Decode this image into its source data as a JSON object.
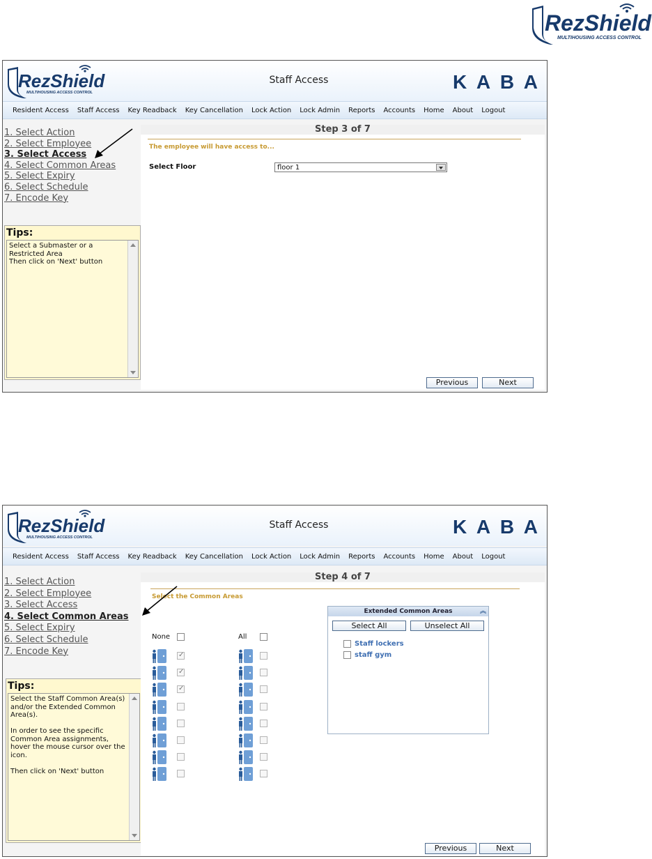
{
  "brand": {
    "name": "RezShield",
    "tagline": "MULTIHOUSING ACCESS CONTROL",
    "partner": "KABA",
    "primary_color": "#173a6b",
    "accent_color": "#c79a32"
  },
  "screens": [
    {
      "title": "Staff Access",
      "nav": [
        "Resident Access",
        "Staff Access",
        "Key Readback",
        "Key Cancellation",
        "Lock Action",
        "Lock Admin",
        "Reports",
        "Accounts",
        "Home",
        "About",
        "Logout"
      ],
      "steps": [
        "1. Select Action",
        "2. Select Employee",
        "3. Select Access",
        "4. Select Common Areas",
        "5. Select Expiry",
        "6. Select Schedule",
        "7. Encode Key"
      ],
      "active_step": 2,
      "tips_title": "Tips:",
      "tips_text": "Select a Submaster or a Restricted Area\nThen click on 'Next' button",
      "step_header": "Step 3 of 7",
      "subheading": "The employee will have access to...",
      "field_label": "Select Floor",
      "field_value": "floor 1",
      "prev_label": "Previous",
      "next_label": "Next"
    },
    {
      "title": "Staff Access",
      "nav": [
        "Resident Access",
        "Staff Access",
        "Key Readback",
        "Key Cancellation",
        "Lock Action",
        "Lock Admin",
        "Reports",
        "Accounts",
        "Home",
        "About",
        "Logout"
      ],
      "steps": [
        "1. Select Action",
        "2. Select Employee",
        "3. Select Access",
        "4. Select Common Areas",
        "5. Select Expiry",
        "6. Select Schedule",
        "7. Encode Key"
      ],
      "active_step": 3,
      "tips_title": "Tips:",
      "tips_text": "Select the Staff Common Area(s) and/or the Extended Common Area(s).\n\nIn order to see the specific Common Area assignments, hover the mouse cursor over the icon.\n\nThen click on 'Next' button",
      "step_header": "Step 4 of 7",
      "subheading": "Select the Common Areas",
      "none_label": "None",
      "all_label": "All",
      "left_checked": [
        true,
        true,
        true,
        false,
        false,
        false,
        false,
        false
      ],
      "right_checked": [
        false,
        false,
        false,
        false,
        false,
        false,
        false,
        false
      ],
      "ext_panel": {
        "title": "Extended Common Areas",
        "select_all": "Select All",
        "unselect_all": "Unselect All",
        "items": [
          "Staff lockers",
          "staff gym"
        ]
      },
      "prev_label": "Previous",
      "next_label": "Next"
    }
  ]
}
